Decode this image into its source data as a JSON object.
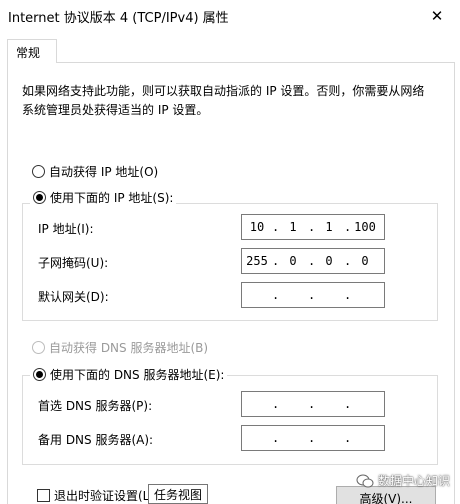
{
  "window": {
    "title": "Internet 协议版本 4 (TCP/IPv4) 属性"
  },
  "tabs": [
    {
      "label": "常规"
    }
  ],
  "description": "如果网络支持此功能，则可以获取自动指派的 IP 设置。否则，你需要从网络系统管理员处获得适当的 IP 设置。",
  "ip": {
    "auto_label": "自动获得 IP 地址(O)",
    "manual_label": "使用下面的 IP 地址(S):",
    "fields": [
      {
        "label": "IP 地址(I):",
        "octets": [
          "10",
          "1",
          "1",
          "100"
        ]
      },
      {
        "label": "子网掩码(U):",
        "octets": [
          "255",
          "0",
          "0",
          "0"
        ]
      },
      {
        "label": "默认网关(D):",
        "octets": [
          "",
          "",
          "",
          ""
        ]
      }
    ]
  },
  "dns": {
    "auto_label": "自动获得 DNS 服务器地址(B)",
    "manual_label": "使用下面的 DNS 服务器地址(E):",
    "fields": [
      {
        "label": "首选 DNS 服务器(P):",
        "octets": [
          "",
          "",
          "",
          ""
        ]
      },
      {
        "label": "备用 DNS 服务器(A):",
        "octets": [
          "",
          "",
          "",
          ""
        ]
      }
    ]
  },
  "footer": {
    "validate_label": "退出时验证设置(L)",
    "tooltip": "任务视图",
    "advanced_label": "高级(V)..."
  },
  "watermark": {
    "text": "数据中心知识"
  },
  "icons": {
    "close": "close-icon",
    "watermark": "wechat-icon"
  }
}
